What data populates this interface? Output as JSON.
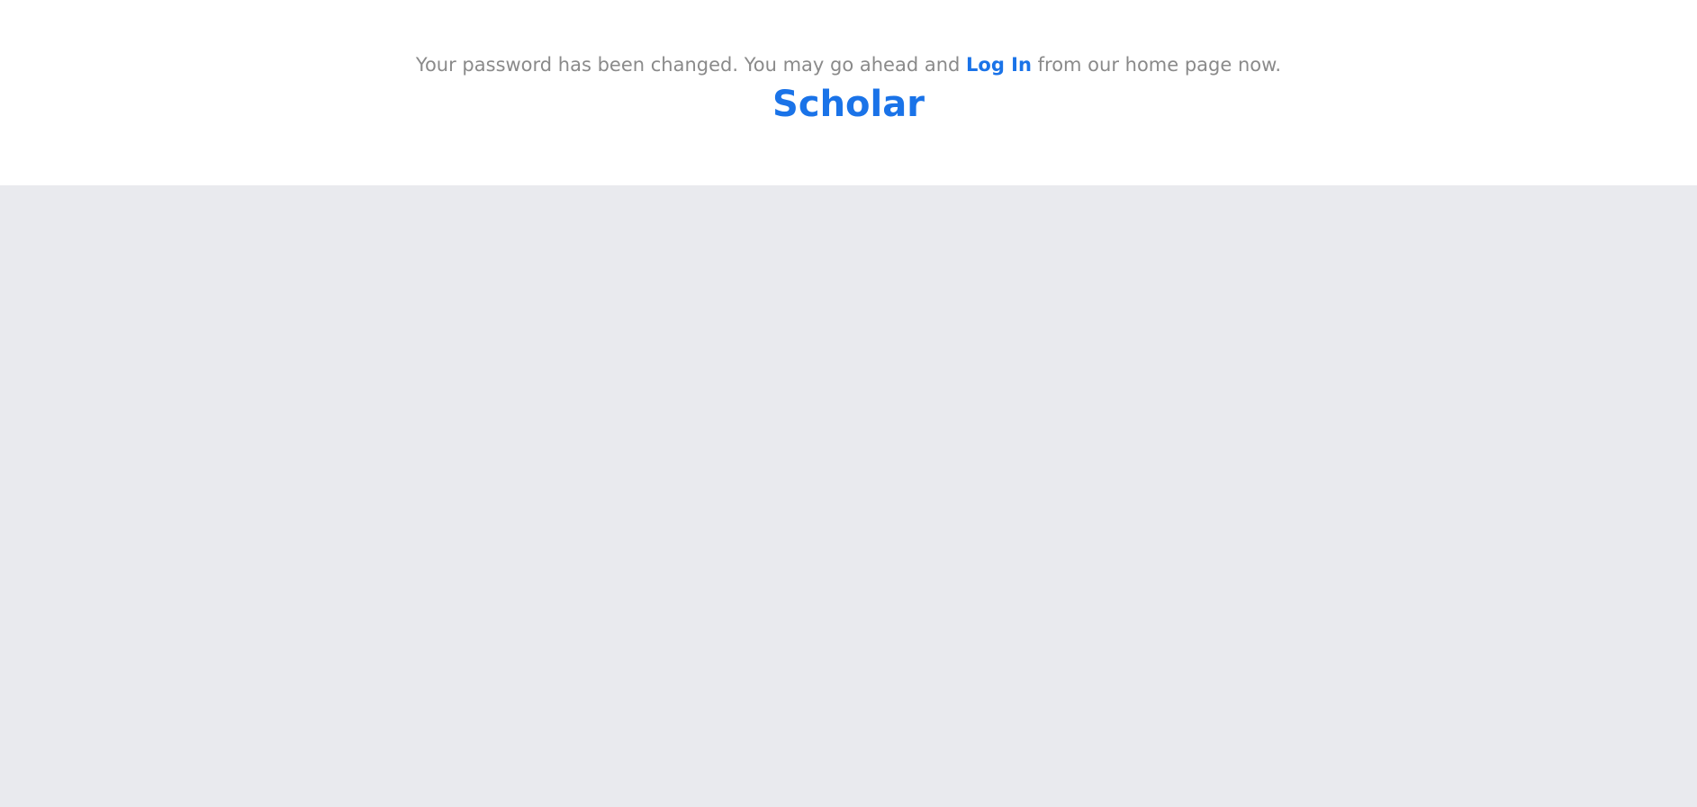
{
  "notice": {
    "before_link": "Your password has been changed. You may go ahead and ",
    "link_label": "Log In",
    "after_link": " from our home page now."
  },
  "brand": {
    "name": "Scholar"
  },
  "colors": {
    "accent": "#1a73e8",
    "muted_text": "#8a8a8a",
    "page_background": "#e9eaee",
    "panel_background": "#ffffff"
  }
}
